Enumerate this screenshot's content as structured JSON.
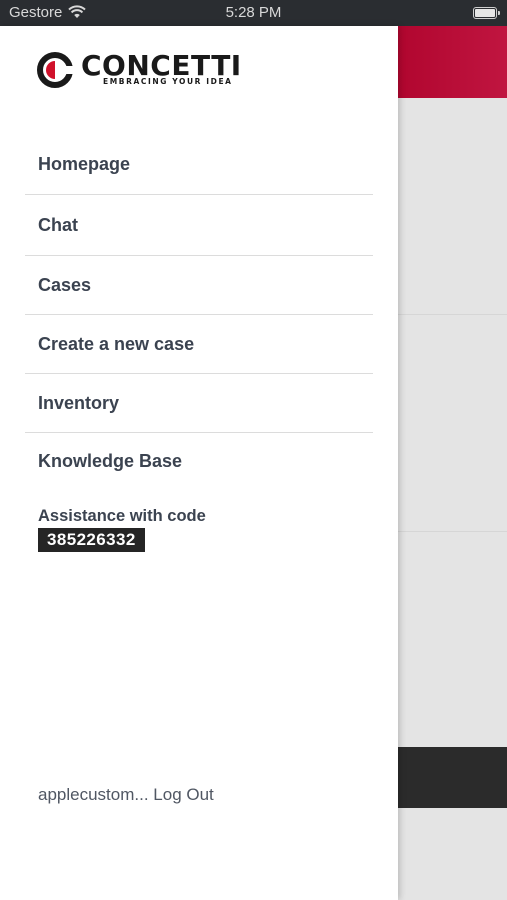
{
  "status_bar": {
    "carrier": "Gestore",
    "time": "5:28 PM",
    "wifi_icon": "wifi-icon",
    "battery_icon": "battery-icon"
  },
  "drawer": {
    "logo": {
      "name": "CONCETTI",
      "tagline": "EMBRACING YOUR IDEA",
      "brand_color": "#d0112b"
    },
    "menu": [
      {
        "label": "Homepage"
      },
      {
        "label": "Chat"
      },
      {
        "label": "Cases"
      },
      {
        "label": "Create a new case"
      },
      {
        "label": "Inventory"
      },
      {
        "label": "Knowledge Base"
      }
    ],
    "assistance": {
      "label": "Assistance with code",
      "code": "385226332"
    },
    "footer": {
      "username": "applecustom...",
      "logout_label": "Log Out"
    }
  },
  "colors": {
    "accent": "#b8092f",
    "text": "#3b4350",
    "status_bar_bg": "#2a2d31"
  }
}
